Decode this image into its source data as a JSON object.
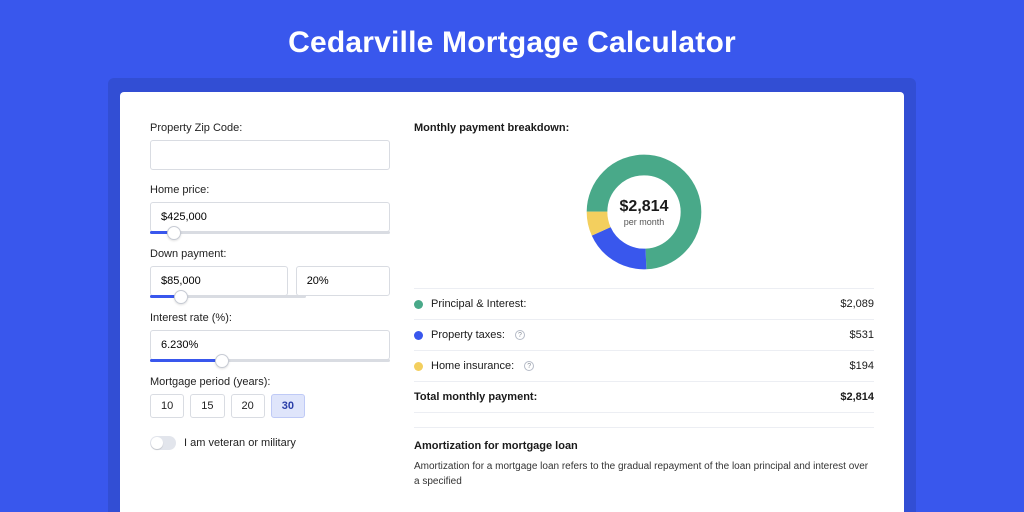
{
  "title": "Cedarville Mortgage Calculator",
  "form": {
    "zip": {
      "label": "Property Zip Code:",
      "value": ""
    },
    "homePrice": {
      "label": "Home price:",
      "value": "$425,000",
      "sliderPct": 10
    },
    "downPayment": {
      "label": "Down payment:",
      "amount": "$85,000",
      "percent": "20%",
      "sliderPct": 20
    },
    "interest": {
      "label": "Interest rate (%):",
      "value": "6.230%",
      "sliderPct": 30
    },
    "period": {
      "label": "Mortgage period (years):",
      "options": [
        "10",
        "15",
        "20",
        "30"
      ],
      "selected": "30"
    },
    "veteran": {
      "label": "I am veteran or military",
      "checked": false
    }
  },
  "breakdown": {
    "title": "Monthly payment breakdown:",
    "centerAmount": "$2,814",
    "centerSub": "per month",
    "items": [
      {
        "label": "Principal & Interest:",
        "value": "$2,089",
        "color": "#49a989",
        "hasInfo": false
      },
      {
        "label": "Property taxes:",
        "value": "$531",
        "color": "#3957ed",
        "hasInfo": true
      },
      {
        "label": "Home insurance:",
        "value": "$194",
        "color": "#f3cf5e",
        "hasInfo": true
      }
    ],
    "totalLabel": "Total monthly payment:",
    "totalValue": "$2,814"
  },
  "chart_data": {
    "type": "pie",
    "title": "Monthly payment breakdown",
    "categories": [
      "Principal & Interest",
      "Property taxes",
      "Home insurance"
    ],
    "values": [
      2089,
      531,
      194
    ],
    "colors": [
      "#49a989",
      "#3957ed",
      "#f3cf5e"
    ],
    "total": 2814,
    "center_label": "$2,814 per month"
  },
  "amortization": {
    "title": "Amortization for mortgage loan",
    "body": "Amortization for a mortgage loan refers to the gradual repayment of the loan principal and interest over a specified"
  }
}
